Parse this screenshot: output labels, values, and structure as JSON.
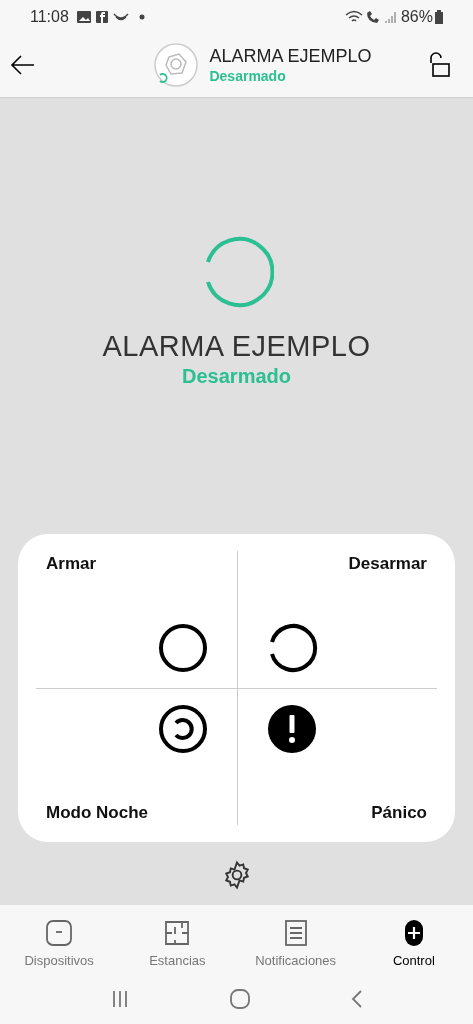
{
  "status_bar": {
    "time": "11:08",
    "battery": "86%"
  },
  "header": {
    "title": "ALARMA EJEMPLO",
    "status": "Desarmado"
  },
  "hero": {
    "title": "ALARMA EJEMPLO",
    "status": "Desarmado"
  },
  "controls": [
    {
      "kind": "arm",
      "label": "Armar"
    },
    {
      "kind": "disarm",
      "label": "Desarmar"
    },
    {
      "kind": "night",
      "label": "Modo Noche"
    },
    {
      "kind": "panic",
      "label": "Pánico"
    }
  ],
  "tabs": [
    {
      "kind": "devices",
      "label": "Dispositivos",
      "selected": false
    },
    {
      "kind": "rooms",
      "label": "Estancias",
      "selected": false
    },
    {
      "kind": "notifications",
      "label": "Notificaciones",
      "selected": false
    },
    {
      "kind": "control",
      "label": "Control",
      "selected": true
    }
  ]
}
